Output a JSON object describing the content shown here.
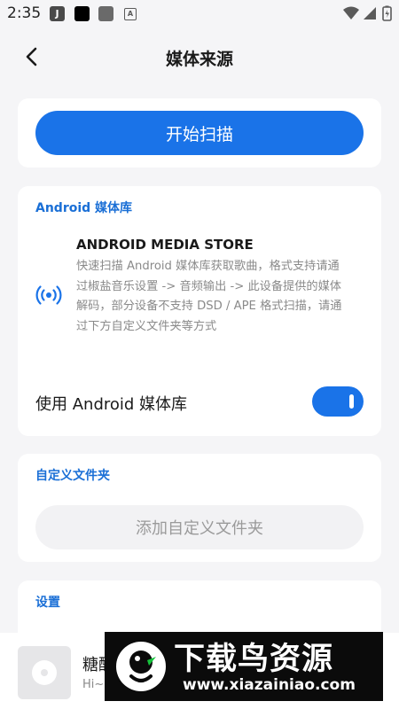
{
  "status_bar": {
    "time": "2:35",
    "icons": [
      "app-j-icon",
      "black-square-icon",
      "gray-square-icon",
      "a-box-icon",
      "wifi-icon",
      "signal-icon",
      "battery-icon"
    ],
    "app_icon_letter": "J",
    "box_letter": "A"
  },
  "header": {
    "title": "媒体来源"
  },
  "scan": {
    "button_label": "开始扫描"
  },
  "android_section": {
    "title": "Android 媒体库",
    "store_heading": "ANDROID MEDIA STORE",
    "description": "快速扫描 Android 媒体库获取歌曲，格式支持请通过椒盐音乐设置 -> 音频输出 -> 此设备提供的媒体解码，部分设备不支持 DSD / APE 格式扫描，请通过下方自定义文件夹等方式",
    "toggle_label": "使用 Android 媒体库",
    "toggle_on": true
  },
  "folder_section": {
    "title": "自定义文件夹",
    "add_button_label": "添加自定义文件夹"
  },
  "settings_section": {
    "title": "设置"
  },
  "player": {
    "title": "糖醋",
    "subtitle": "Hi~"
  },
  "watermark": {
    "title": "下载鸟资源",
    "url": "www.xiazainiao.com"
  },
  "colors": {
    "accent": "#1a73e8",
    "section_title": "#1a6fd6",
    "background": "#f5f5f7"
  }
}
